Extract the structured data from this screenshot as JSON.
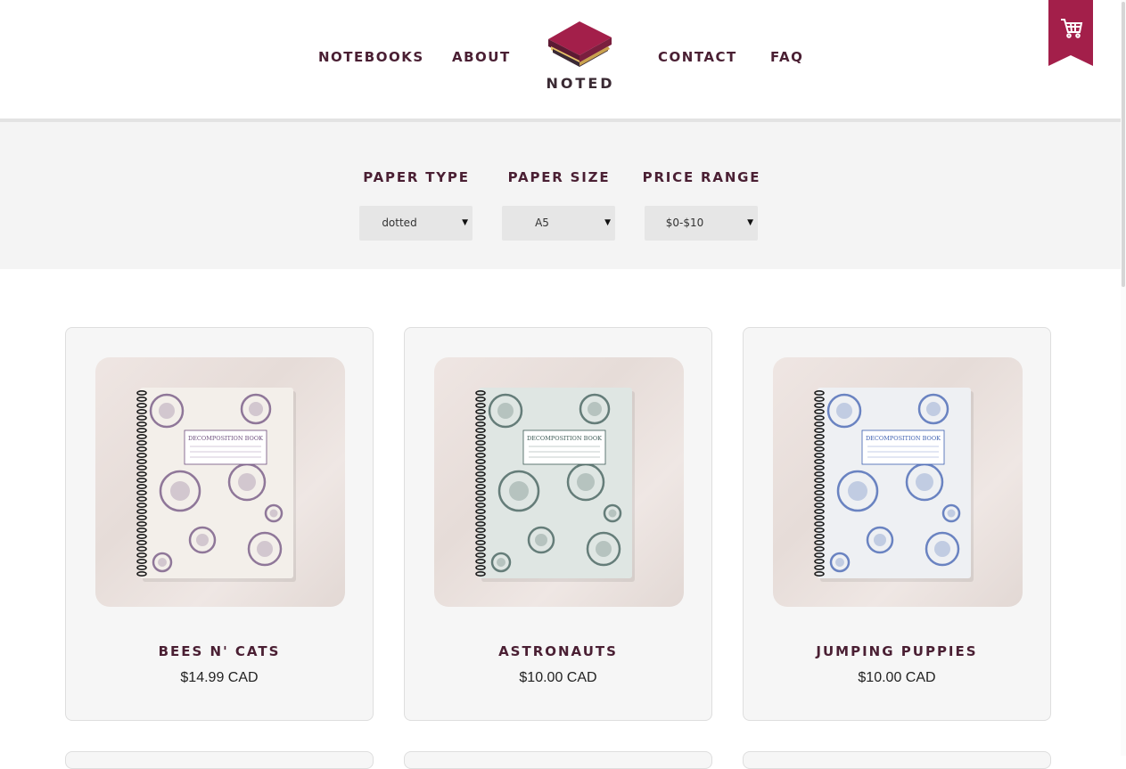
{
  "nav": {
    "left": [
      "NOTEBOOKS",
      "ABOUT"
    ],
    "right": [
      "CONTACT",
      "FAQ"
    ],
    "logo_text": "NOTED"
  },
  "icons": {
    "logo": "stacked-notebooks-logo",
    "cart": "shopping-cart-icon"
  },
  "colors": {
    "accent": "#a31f4a",
    "text_dark": "#4a1f33",
    "filter_bg": "#f4f4f4",
    "card_bg": "#f6f6f6"
  },
  "filters": [
    {
      "label": "PAPER TYPE",
      "value": "dotted"
    },
    {
      "label": "PAPER SIZE",
      "value": "A5"
    },
    {
      "label": "PRICE RANGE",
      "value": "$0-$10"
    }
  ],
  "products": [
    {
      "name": "BEES N' CATS",
      "price": "$14.99 CAD",
      "cover_text": "DECOMPOSITION BOOK",
      "ink": "#6e4f7e",
      "paper": "#f3efea"
    },
    {
      "name": "ASTRONAUTS",
      "price": "$10.00 CAD",
      "cover_text": "DECOMPOSITION BOOK",
      "ink": "#3c5a55",
      "paper": "#dfe6e3"
    },
    {
      "name": "JUMPING PUPPIES",
      "price": "$10.00 CAD",
      "cover_text": "DECOMPOSITION BOOK",
      "ink": "#3d5fb0",
      "paper": "#eef0f3"
    }
  ]
}
